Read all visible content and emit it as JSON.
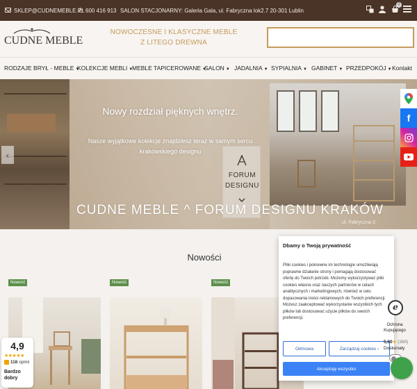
{
  "topbar": {
    "email": "SKLEP@CUDNEMEBLE.PL",
    "phone": "600 416 913",
    "salon_label": "SALON STACJONARNY:",
    "salon_address": " Galeria Gala, ul. Fabryczna lok2.7 20-301 Lublin",
    "cart_count": "0",
    "icons": [
      "envelope-icon",
      "phone-icon",
      "language-icon",
      "user-icon",
      "cart-icon",
      "menu-icon"
    ]
  },
  "header": {
    "logo_text": "CUDNE MEBLE",
    "tagline_line1": "NOWOCZESNE I KLASYCZNE MEBLE",
    "tagline_line2": "Z LITEGO DREWNA",
    "search_placeholder": ""
  },
  "nav": {
    "items": [
      {
        "label": "RODZAJE BRYŁ - MEBLE",
        "caret": true
      },
      {
        "label": "KOLEKCJE MEBLI",
        "caret": true
      },
      {
        "label": "MEBLE TAPICEROWANE",
        "caret": true
      },
      {
        "label": "SALON",
        "caret": true
      },
      {
        "label": "JADALNIA",
        "caret": true
      },
      {
        "label": "SYPIALNIA",
        "caret": true
      },
      {
        "label": "GABINET",
        "caret": true
      },
      {
        "label": "PRZEDPOKÓJ",
        "caret": true
      },
      {
        "label": "Kontakt",
        "caret": false
      }
    ]
  },
  "hero": {
    "title": "Nowy rozdział pięknych wnętrz.",
    "subtitle_line1": "Nasze wyjątkowe kolekcje znajdziesz teraz w samym sercu",
    "subtitle_line2": "krakowskiego designu",
    "forum_line1": "FORUM",
    "forum_line2": "DESIGNU",
    "banner_text": "CUDNE MEBLE ^ FORUM DESIGNU KRAKÓW",
    "address": "ul. Fabryczna 3"
  },
  "social": {
    "items": [
      "google-maps-icon",
      "facebook-icon",
      "instagram-icon",
      "youtube-icon"
    ],
    "facebook_glyph": "f",
    "colors": {
      "maps": "#ffffff",
      "facebook": "#1877f2",
      "instagram": "#d6249f",
      "youtube": "#e62117"
    }
  },
  "section": {
    "title": "Nowości",
    "badge": "Nowość"
  },
  "rating": {
    "score": "4,9",
    "stars": "★★★★★",
    "count": "118",
    "count_label": "opinii",
    "label_line1": "Bardzo",
    "label_line2": "dobry"
  },
  "cookie": {
    "title": "Dbamy o Twoją prywatność",
    "text": "Pliki cookies i pokrewne im technologie umożliwiają poprawne działanie strony i pomagają dostosować ofertę do Twoich potrzeb. Możemy wykorzystywać pliki cookies własne oraz naszych partnerów w celach analitycznych i marketingowych, również w celu dopasowania treści reklamowych do Twoich preferencji. Możesz zaakceptować wykorzystanie wszystkich tych plików lub dostosować użycie plików do swoich preferencji.",
    "reject": "Odmowa",
    "manage": "Zarządzaj cookies",
    "accept": "Akceptuję wszystko"
  },
  "trust": {
    "line1": "Ochrona",
    "line2": "Kupującego",
    "score": "5,00",
    "count": "(360)",
    "label": "Doskonały"
  },
  "colors": {
    "topbar": "#4a3427",
    "accent": "#c59a5b",
    "badge_green": "#5c8f4a",
    "cookie_blue": "#3b82f6"
  }
}
